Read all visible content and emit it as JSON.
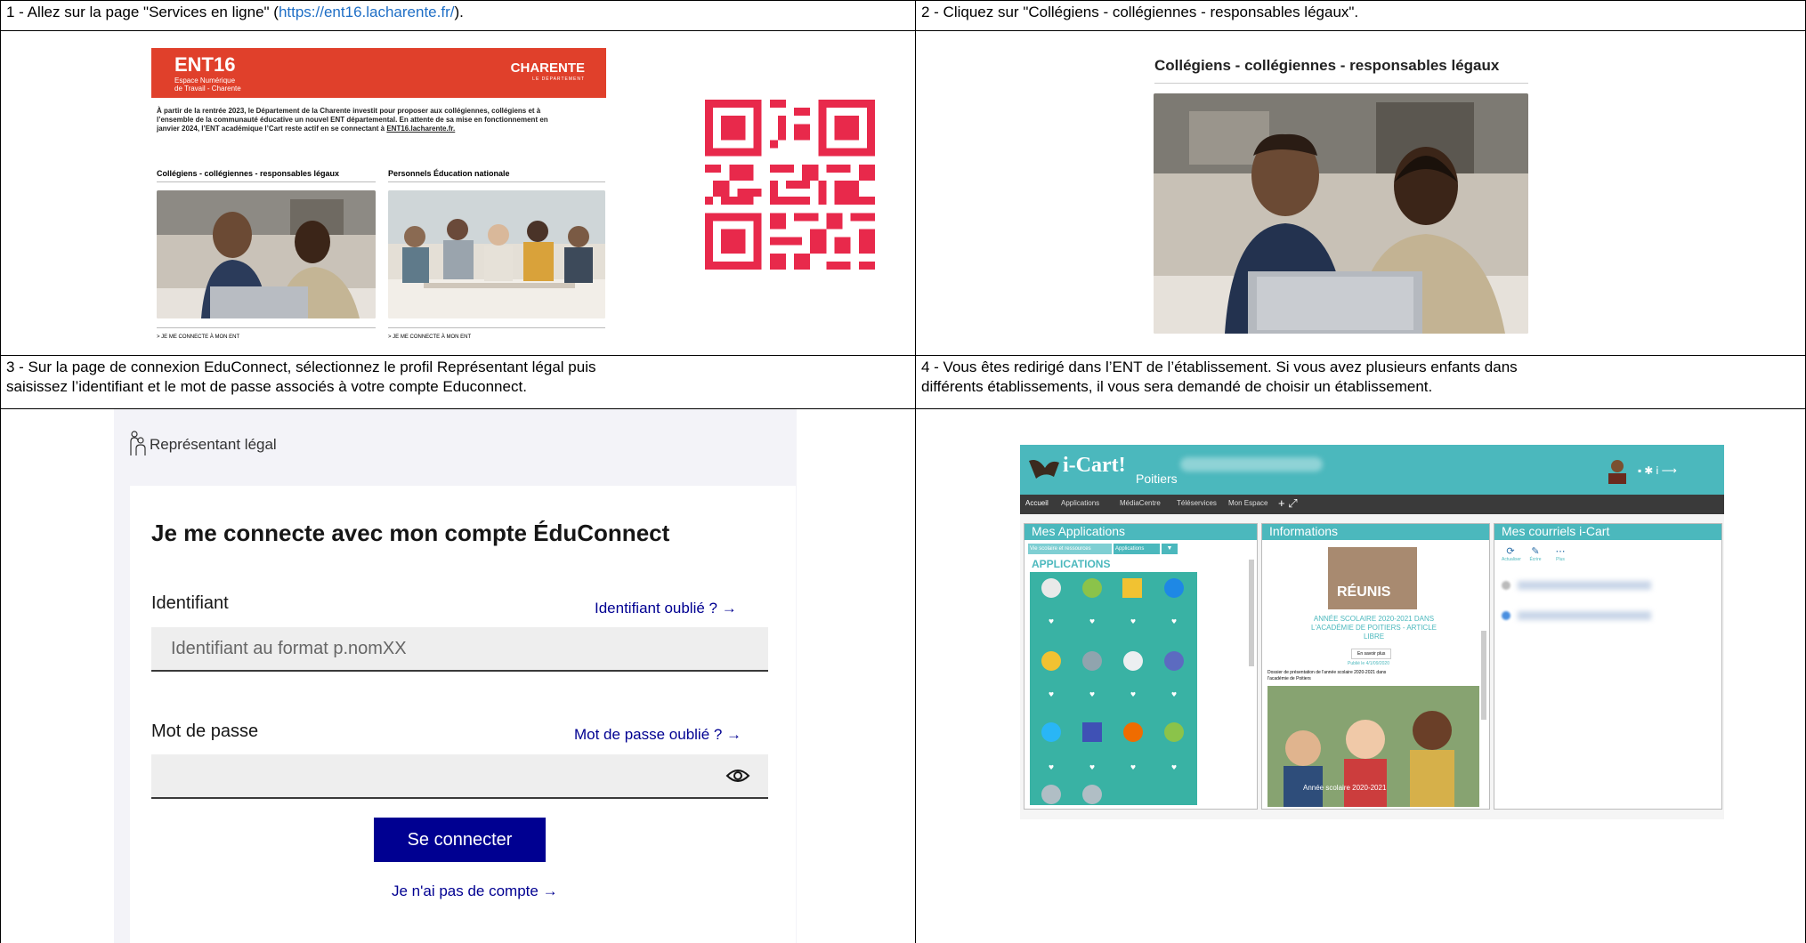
{
  "steps": {
    "s1": {
      "caption_prefix": "1 - Allez sur la page \"Services en ligne\" (",
      "link": "https://ent16.lacharente.fr/",
      "caption_suffix": ")."
    },
    "s2": {
      "caption": "2 - Cliquez sur \"Collégiens - collégiennes - responsables légaux\"."
    },
    "s3": {
      "caption_line1": "3 - Sur la page de connexion EduConnect, sélectionnez le profil Représentant légal puis",
      "caption_line2": "saisissez l’identifiant et le mot de passe associés à votre compte Educonnect."
    },
    "s4": {
      "caption_line1": "4 - Vous êtes redirigé dans l’ENT de l’établissement. Si vous avez plusieurs enfants dans",
      "caption_line2": "différents établissements, il vous sera demandé de choisir un établissement."
    }
  },
  "ent16": {
    "logo": "ENT16",
    "tagline1": "Espace Numérique",
    "tagline2": "de Travail - Charente",
    "dept": "CHARENTE",
    "dept_sub": "LE DÉPARTEMENT",
    "intro1": "À partir de la rentrée 2023, le Département de la Charente investit pour proposer aux collégiennes, collégiens et à",
    "intro2": "l’ensemble de la communauté éducative un nouvel ENT départemental. En attente de sa mise en fonctionnement en",
    "intro3": "janvier 2024, l’ENT académique l’Cart reste actif en se connectant à",
    "intro_link": "ENT16.lacharente.fr.",
    "col1_title": "Collégiens - collégiennes - responsables légaux",
    "col2_title": "Personnels Éducation nationale",
    "col1_link": "> JE ME CONNECTE À MON ENT",
    "col2_link": "> JE ME CONNECTE À MON ENT"
  },
  "panel2": {
    "heading": "Collégiens - collégiennes - responsables légaux"
  },
  "educonnect": {
    "profile_label": "Représentant légal",
    "title": "Je me connecte avec mon compte ÉduConnect",
    "id_label": "Identifiant",
    "id_forgot": "Identifiant oublié ? →",
    "id_placeholder": "Identifiant au format p.nomXX",
    "pw_label": "Mot de passe",
    "pw_forgot": "Mot de passe oublié ? →",
    "submit": "Se connecter",
    "no_account": "Je n'ai pas de compte →"
  },
  "icart": {
    "brand": "i-Cart!",
    "city": "Poitiers",
    "menu": [
      "Accueil",
      "Applications",
      "MédiaCentre",
      "Téléservices",
      "Mon Espace"
    ],
    "panel_apps": "Mes Applications",
    "apps_tab1": "Vie scolaire et ressources",
    "apps_tab2": "Applications",
    "apps_section": "APPLICATIONS",
    "panel_info": "Informations",
    "info_photo_text": "RÉUNIS",
    "info_title1": "ANNÉE SCOLAIRE 2020-2021 DANS",
    "info_title2": "L'ACADÉMIE DE POITIERS - ARTICLE",
    "info_title3": "LIBRE",
    "info_more": "En savoir plus",
    "info_date": "Publié le 4/1/09/2020",
    "info_desc1": "Dossier de présentation de l'année scolaire 2020-2021 dans",
    "info_desc2": "l'académie de Poitiers",
    "info_photo2_text": "Année scolaire 2020-2021",
    "panel_mail": "Mes courriels i-Cart",
    "mail_actions": [
      "Actualiser",
      "Écrire",
      "Plus"
    ]
  }
}
